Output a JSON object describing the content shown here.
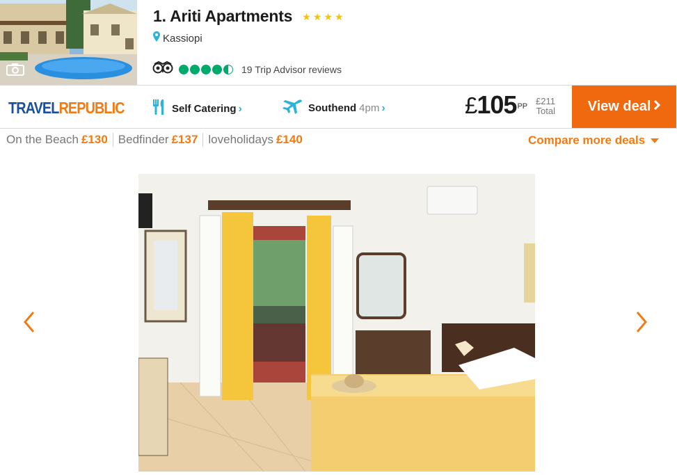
{
  "hotel": {
    "title": "1. Ariti Apartments",
    "stars": 4,
    "location": "Kassiopi",
    "tripadvisor_rating": 4.5,
    "tripadvisor_reviews": "19 Trip Advisor reviews"
  },
  "deal": {
    "provider": {
      "part1": "TRAVEL",
      "part2": "REPUBLIC"
    },
    "board": "Self Catering",
    "flight_airport": "Southend",
    "flight_time": "4pm",
    "price_currency": "£",
    "price_value": "105",
    "price_pp": "PP",
    "total_price": "£211",
    "total_label": "Total",
    "view_deal_label": "View deal"
  },
  "compare": {
    "providers": [
      {
        "name": "On the Beach",
        "price": "£130"
      },
      {
        "name": "Bedfinder",
        "price": "£137"
      },
      {
        "name": "loveholidays",
        "price": "£140"
      }
    ],
    "more_label": "Compare more deals"
  },
  "icons": {
    "location": "map-pin-icon",
    "camera": "camera-icon",
    "tripadvisor": "owl-icon",
    "board": "fork-knife-icon",
    "flight": "plane-icon",
    "prev": "chevron-left-icon",
    "next": "chevron-right-icon"
  },
  "colors": {
    "accent": "#f07b14",
    "button": "#f0690f",
    "brand_blue": "#1a4f9c",
    "link_blue": "#2bb3d9",
    "tripadvisor_green": "#00aa6c",
    "star": "#f4c400"
  }
}
